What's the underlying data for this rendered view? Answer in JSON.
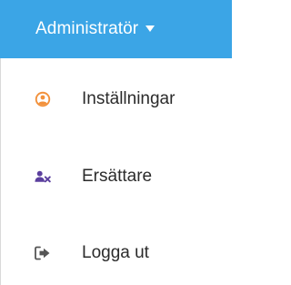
{
  "header": {
    "label": "Administratör"
  },
  "menu": {
    "items": [
      {
        "label": "Inställningar",
        "icon": "user-circle-icon",
        "icon_color": "#f2913c"
      },
      {
        "label": "Ersättare",
        "icon": "user-remove-icon",
        "icon_color": "#5b3f9e"
      },
      {
        "label": "Logga ut",
        "icon": "sign-out-icon",
        "icon_color": "#555555"
      }
    ]
  },
  "colors": {
    "header_bg": "#3ba5e6",
    "header_text": "#ffffff",
    "item_text": "#2b2b2b"
  }
}
